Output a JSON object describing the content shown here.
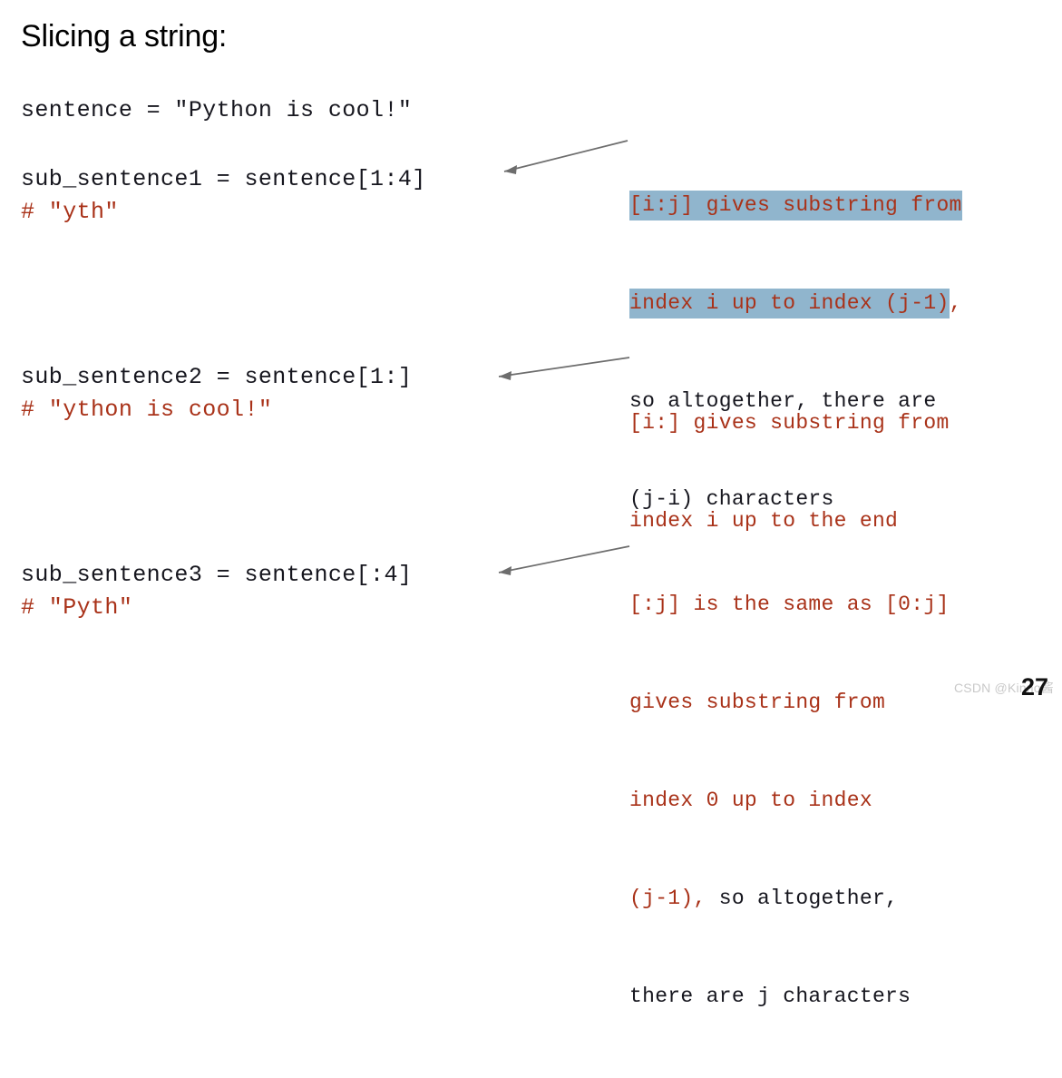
{
  "slide": {
    "title": "Slicing a string:",
    "page_number": "27",
    "watermark": "CSDN @Kinno酱",
    "colors": {
      "background": "#ffffff",
      "code_text": "#16161e",
      "comment_red": "#a93219",
      "highlight_blue": "#90b5cd",
      "arrow_gray": "#6d6d6d",
      "watermark_gray": "#c9c9c9"
    }
  },
  "code": {
    "blocks": [
      {
        "id": "assign-sentence",
        "lines": [
          {
            "text": "sentence = \"Python is cool!\"",
            "style": "code"
          }
        ]
      },
      {
        "id": "slice-1",
        "lines": [
          {
            "text": "sub_sentence1 = sentence[1:4]",
            "style": "code"
          },
          {
            "text": "# \"yth\"",
            "style": "comment"
          }
        ]
      },
      {
        "id": "slice-2",
        "lines": [
          {
            "text": "sub_sentence2 = sentence[1:]",
            "style": "code"
          },
          {
            "text": "# \"ython is cool!\"",
            "style": "comment"
          }
        ]
      },
      {
        "id": "slice-3",
        "lines": [
          {
            "text": "sub_sentence3 = sentence[:4]",
            "style": "code"
          },
          {
            "text": "# \"Pyth\"",
            "style": "comment"
          }
        ]
      }
    ]
  },
  "annotations": [
    {
      "id": "note-i-j",
      "lines": [
        [
          {
            "text": "[i:j] gives substring from",
            "color": "red",
            "highlight": true
          }
        ],
        [
          {
            "text": "index i up to index (j-1)",
            "color": "red",
            "highlight": true
          },
          {
            "text": ",",
            "color": "red",
            "highlight": false
          }
        ],
        [
          {
            "text": "so altogether, there are",
            "color": "dark",
            "highlight": false
          }
        ],
        [
          {
            "text": "(j-i) characters",
            "color": "dark",
            "highlight": false
          }
        ]
      ]
    },
    {
      "id": "note-i-open",
      "lines": [
        [
          {
            "text": "[i:] gives substring from",
            "color": "red",
            "highlight": false
          }
        ],
        [
          {
            "text": "index i up to the end",
            "color": "red",
            "highlight": false
          }
        ]
      ]
    },
    {
      "id": "note-open-j",
      "lines": [
        [
          {
            "text": "[:j] is the same as [0:j]",
            "color": "red",
            "highlight": false
          }
        ],
        [
          {
            "text": "gives substring from",
            "color": "red",
            "highlight": false
          }
        ],
        [
          {
            "text": "index 0 up to index",
            "color": "red",
            "highlight": false
          }
        ],
        [
          {
            "text": "(j-1),",
            "color": "red",
            "highlight": false
          },
          {
            "text": " so altogether,",
            "color": "dark",
            "highlight": false
          }
        ],
        [
          {
            "text": "there are j characters",
            "color": "dark",
            "highlight": false
          }
        ]
      ]
    }
  ],
  "connectors": [
    {
      "id": "arrow-slice-1",
      "from_label": "note-i-j",
      "to_label": "slice-1"
    },
    {
      "id": "arrow-slice-2",
      "from_label": "note-i-open",
      "to_label": "slice-2"
    },
    {
      "id": "arrow-slice-3",
      "from_label": "note-open-j",
      "to_label": "slice-3"
    }
  ]
}
